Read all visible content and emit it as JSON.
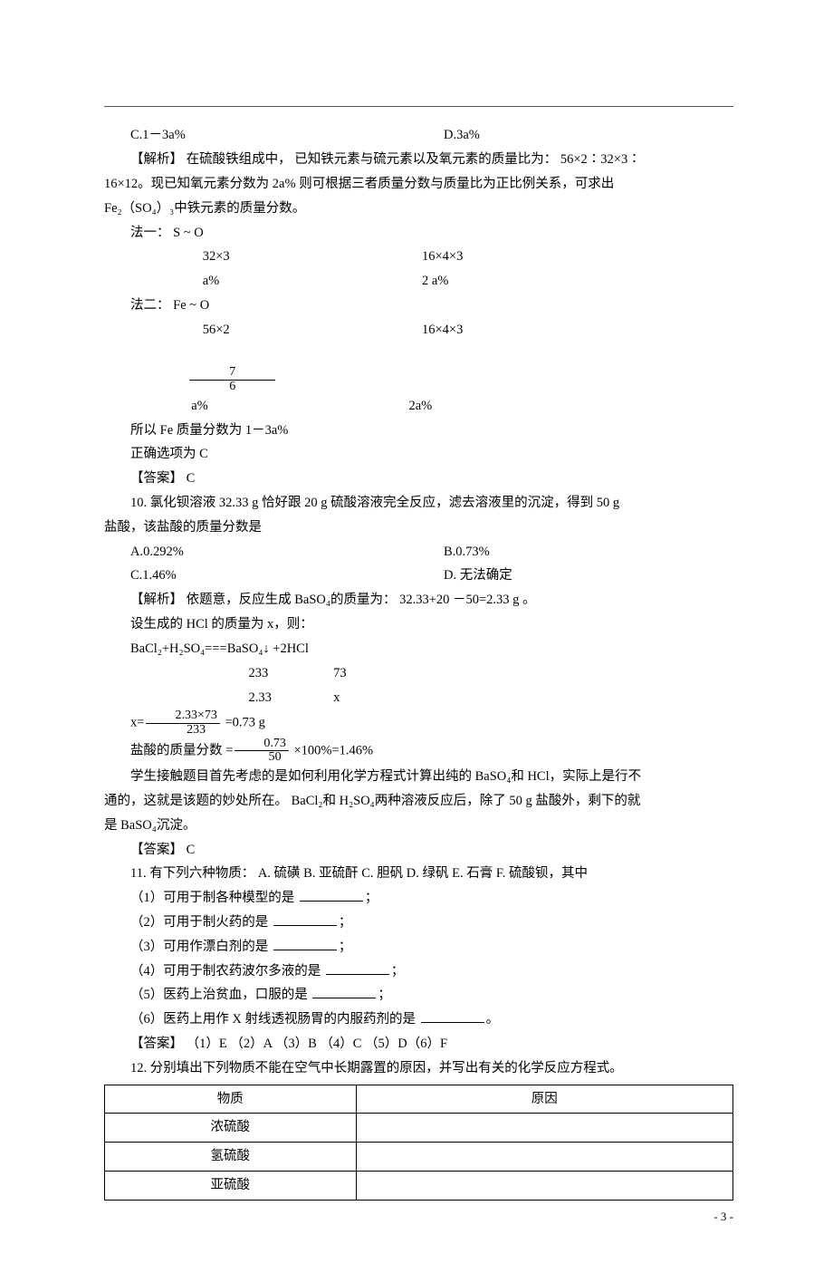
{
  "options_top": {
    "c": "C.1－3a%",
    "d": "D.3a%"
  },
  "p1": {
    "l1": "【解析】  在硫酸铁组成中，  已知铁元素与硫元素以及氧元素的质量比为：     56×2∶32×3∶",
    "l2": "16×12。现已知氧元素分数为    2a%  则可根据三者质量分数与质量比为正比例关系，可求出",
    "l3": "Fe₂（SO₄）₃中铁元素的质量分数。"
  },
  "method1": {
    "head": "法一：  S                ~                    O",
    "r1_c1": "32×3",
    "r1_c2": "16×4×3",
    "r2_c1": "a%",
    "r2_c2": "2  a%"
  },
  "method2": {
    "head": "法二：  Fe             ~                      O",
    "r1_c1": "56×2",
    "r1_c2": "16×4×3",
    "frac_num": "7",
    "frac_den": "6",
    "frac_tail": " a%",
    "r2_c2": "2a%"
  },
  "concl1": "所以 Fe 质量分数为   1－3a%",
  "concl2": "正确选项为   C",
  "ans9": "【答案】  C",
  "q10": {
    "l1": "10. 氯化钡溶液   32.33  g 恰好跟  20 g 硫酸溶液完全反应，滤去溶液里的沉淀，得到       50 g",
    "l2": "盐酸，该盐酸的质量分数是",
    "a": "A.0.292%",
    "b": "B.0.73%",
    "c": "C.1.46%",
    "d": "D. 无法确定"
  },
  "sol10": {
    "l1": "【解析】   依题意，反应生成    BaSO₄的质量为：   32.33+20 －50=2.33 g 。",
    "l2": "设生成的   HCl 的质量为  x，则：",
    "eq": "BaCl₂+H₂SO₄===BaSO₄↓ +2HCl",
    "r1a": "233",
    "r1b": "73",
    "r2a": "2.33",
    "r2b": "x",
    "xeq_pre": "x=",
    "xfrac_num": "2.33×73",
    "xfrac_den": "233",
    "xeq_post": " =0.73 g",
    "masspre": "盐酸的质量分数   =",
    "mfrac_num": "0.73",
    "mfrac_den": "50",
    "masspost": " ×100%=1.46%",
    "exp1": "学生接触题目首先考虑的是如何利用化学方程式计算出纯的        BaSO₄和 HCl，实际上是行不",
    "exp2": "通的，这就是该题的妙处所在。    BaCl₂和 H₂SO₄两种溶液反应后，除了    50 g  盐酸外，剩下的就",
    "exp3": "是 BaSO₄沉淀。"
  },
  "ans10": "【答案】  C",
  "q11": {
    "stem": "11. 有下列六种物质：  A. 硫磺   B.  亚硫酐   C.  胆矾   D.  绿矾   E.  石膏   F.  硫酸钡，其中",
    "p1": "（1）可用于制各种模型的是   ",
    "p2": "（2）可用于制火药的是   ",
    "p3": "（3）可用作漂白剂的是   ",
    "p4": "（4）可用于制农药波尔多液的是   ",
    "p5": "（5）医药上治贫血，口服的是   ",
    "p6": "（6）医药上用作   X 射线透视肠胃的内服药剂的是   ",
    "semi": "；",
    "period": "。",
    "ans": "【答案】  （1）E  （2）A  （3）B  （4）C  （5）D（6）F"
  },
  "q12": {
    "stem": "12. 分别填出下列物质不能在空气中长期露置的原因，并写出有关的化学反应方程式。",
    "h1": "物质",
    "h2": "原因",
    "r1": "浓硫酸",
    "r2": "氢硫酸",
    "r3": "亚硫酸"
  },
  "footer": "- 3 -"
}
